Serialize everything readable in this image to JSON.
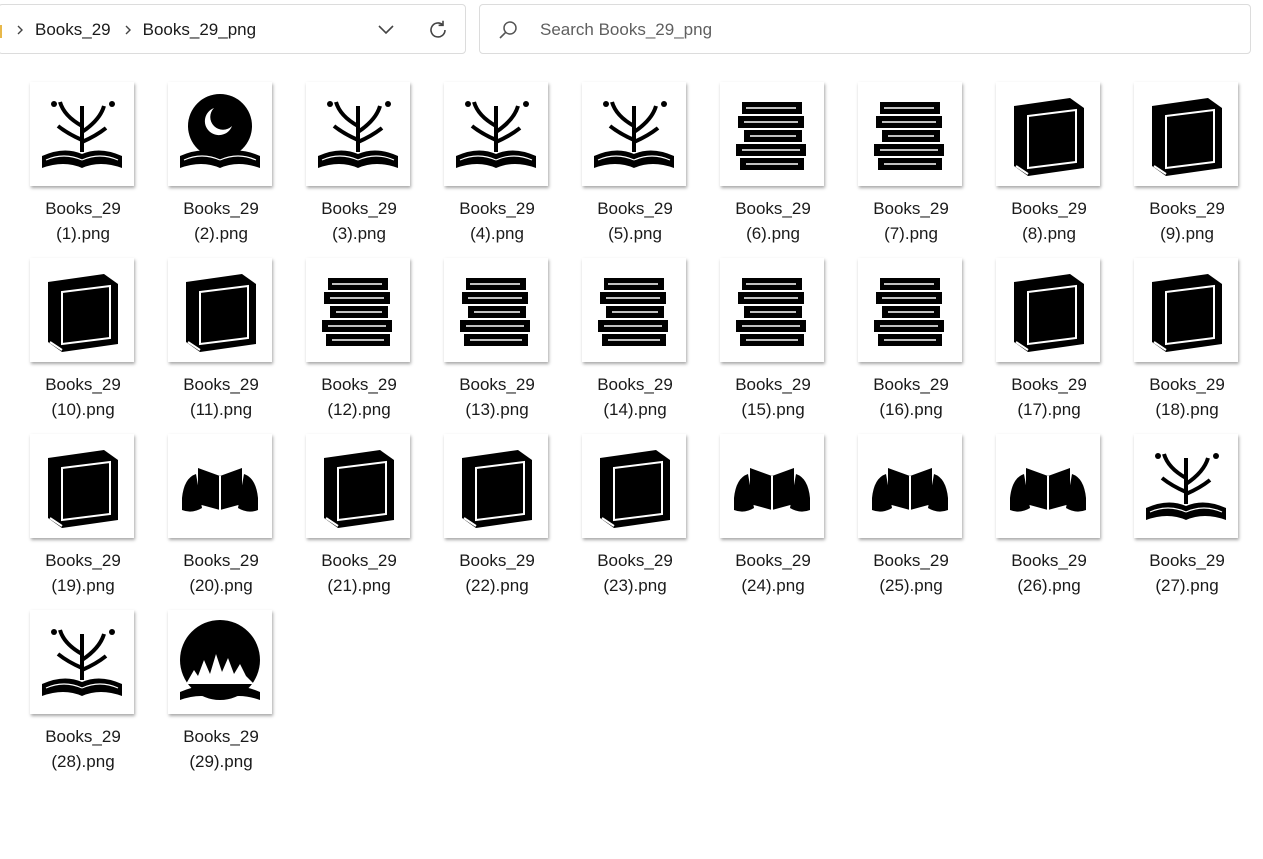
{
  "address_bar": {
    "breadcrumbs": [
      "Books_29",
      "Books_29_png"
    ]
  },
  "search": {
    "placeholder": "Search Books_29_png",
    "value": ""
  },
  "files": [
    {
      "name_line1": "Books_29",
      "name_line2": "(1).png",
      "icon": "open-book-plants"
    },
    {
      "name_line1": "Books_29",
      "name_line2": "(2).png",
      "icon": "open-book-moon"
    },
    {
      "name_line1": "Books_29",
      "name_line2": "(3).png",
      "icon": "open-book-bird"
    },
    {
      "name_line1": "Books_29",
      "name_line2": "(4).png",
      "icon": "open-book-sprout"
    },
    {
      "name_line1": "Books_29",
      "name_line2": "(5).png",
      "icon": "open-book-stars"
    },
    {
      "name_line1": "Books_29",
      "name_line2": "(6).png",
      "icon": "book-stack-open"
    },
    {
      "name_line1": "Books_29",
      "name_line2": "(7).png",
      "icon": "book-stack-bird"
    },
    {
      "name_line1": "Books_29",
      "name_line2": "(8).png",
      "icon": "closed-book"
    },
    {
      "name_line1": "Books_29",
      "name_line2": "(9).png",
      "icon": "ornate-book"
    },
    {
      "name_line1": "Books_29",
      "name_line2": "(10).png",
      "icon": "leaf-cover-book"
    },
    {
      "name_line1": "Books_29",
      "name_line2": "(11).png",
      "icon": "zodiac-book"
    },
    {
      "name_line1": "Books_29",
      "name_line2": "(12).png",
      "icon": "tall-book-stack"
    },
    {
      "name_line1": "Books_29",
      "name_line2": "(13).png",
      "icon": "book-stack-shelf"
    },
    {
      "name_line1": "Books_29",
      "name_line2": "(14).png",
      "icon": "book-stack-bow"
    },
    {
      "name_line1": "Books_29",
      "name_line2": "(15).png",
      "icon": "book-stack-leaves"
    },
    {
      "name_line1": "Books_29",
      "name_line2": "(16).png",
      "icon": "neat-book-stack"
    },
    {
      "name_line1": "Books_29",
      "name_line2": "(17).png",
      "icon": "clasp-book"
    },
    {
      "name_line1": "Books_29",
      "name_line2": "(18).png",
      "icon": "label-book"
    },
    {
      "name_line1": "Books_29",
      "name_line2": "(19).png",
      "icon": "cloud-book"
    },
    {
      "name_line1": "Books_29",
      "name_line2": "(20).png",
      "icon": "hands-book-cross"
    },
    {
      "name_line1": "Books_29",
      "name_line2": "(21).png",
      "icon": "flame-book"
    },
    {
      "name_line1": "Books_29",
      "name_line2": "(22).png",
      "icon": "lined-book"
    },
    {
      "name_line1": "Books_29",
      "name_line2": "(23).png",
      "icon": "flower-book"
    },
    {
      "name_line1": "Books_29",
      "name_line2": "(24).png",
      "icon": "hands-book-orb"
    },
    {
      "name_line1": "Books_29",
      "name_line2": "(25).png",
      "icon": "hands-book-plant"
    },
    {
      "name_line1": "Books_29",
      "name_line2": "(26).png",
      "icon": "hands-book-sprout"
    },
    {
      "name_line1": "Books_29",
      "name_line2": "(27).png",
      "icon": "open-book-butterflies"
    },
    {
      "name_line1": "Books_29",
      "name_line2": "(28).png",
      "icon": "open-book-tree"
    },
    {
      "name_line1": "Books_29",
      "name_line2": "(29).png",
      "icon": "open-book-city-night"
    }
  ]
}
